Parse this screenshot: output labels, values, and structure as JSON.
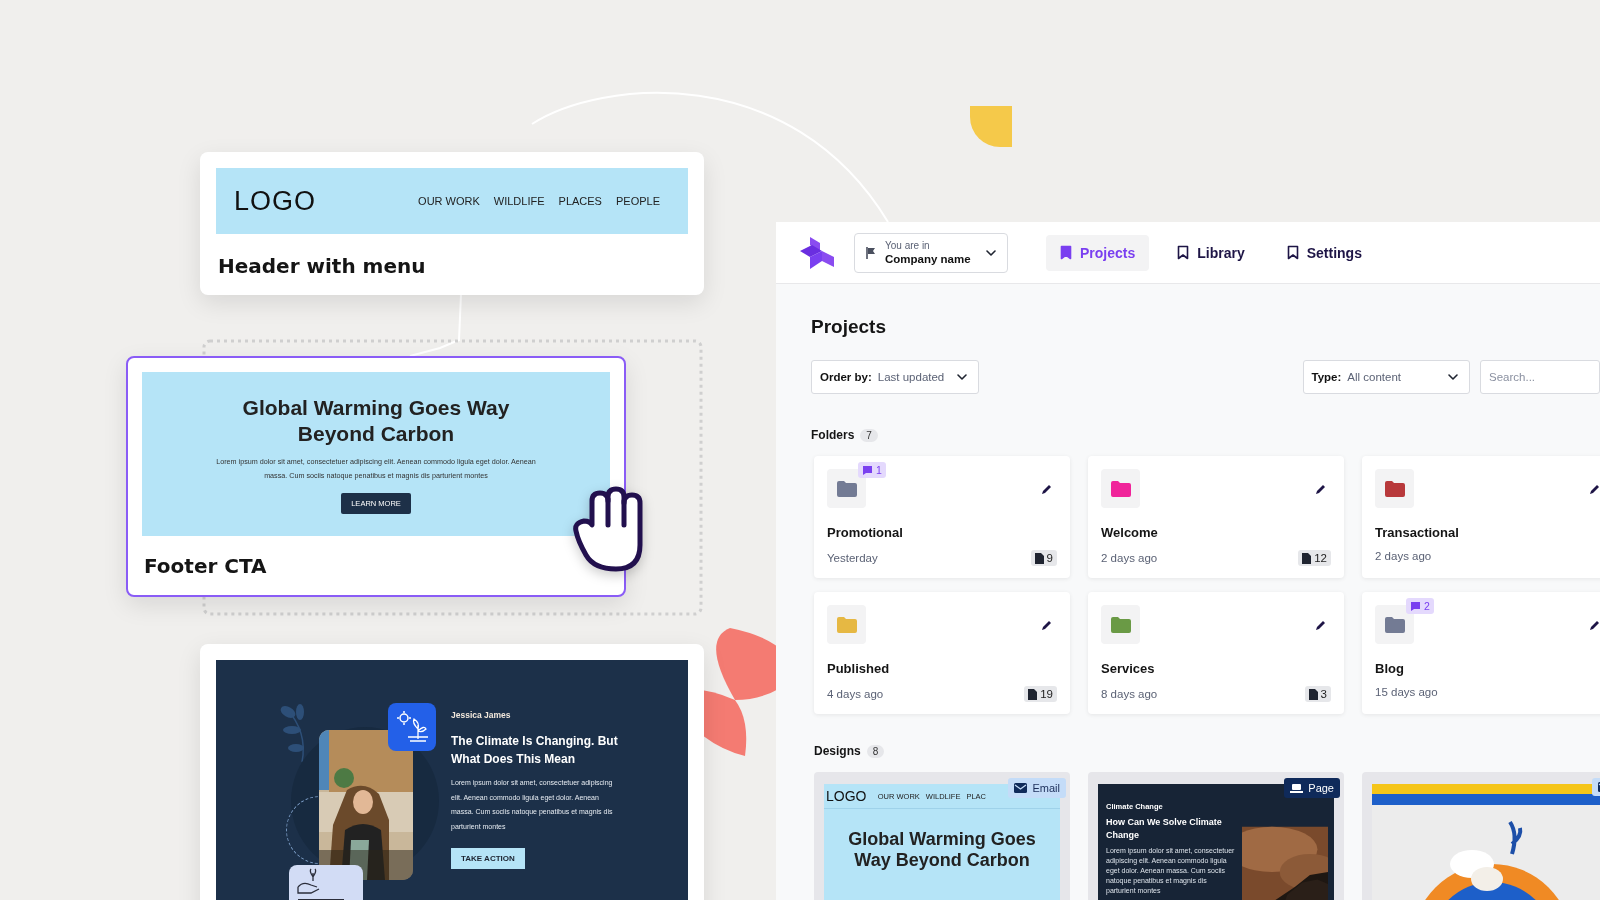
{
  "templates": [
    {
      "kind": "header",
      "logo": "LOGO",
      "menu": [
        "OUR WORK",
        "WILDLIFE",
        "PLACES",
        "PEOPLE"
      ],
      "title": "Header with menu",
      "selected": false
    },
    {
      "kind": "cta",
      "headline": "Global Warming Goes Way Beyond Carbon",
      "body": "Lorem ipsum dolor sit amet, consectetuer adipiscing elit. Aenean commodo ligula eget dolor. Aenean massa. Cum sociis natoque penatibus et magnis dis parturient montes",
      "button": "LEARN MORE",
      "title": "Footer CTA",
      "selected": true
    },
    {
      "kind": "article",
      "author": "Jessica James",
      "headline": "The Climate Is Changing. But What Does This Mean",
      "body": "Lorem ipsum dolor sit amet, consectetuer adipiscing elit. Aenean commodo ligula eget dolor. Aenean massa. Cum sociis natoque penatibus et magnis dis parturient montes",
      "button": "TAKE ACTION",
      "selected": false
    }
  ],
  "app": {
    "company": {
      "label": "You are in",
      "name": "Company name"
    },
    "nav": [
      {
        "label": "Projects",
        "selected": true
      },
      {
        "label": "Library",
        "selected": false
      },
      {
        "label": "Settings",
        "selected": false
      }
    ],
    "title": "Projects",
    "order": {
      "label": "Order by:",
      "value": "Last updated"
    },
    "type": {
      "label": "Type:",
      "value": "All content"
    },
    "search": {
      "placeholder": "Search..."
    },
    "folders": {
      "label": "Folders",
      "count": "7",
      "items": [
        {
          "name": "Promotional",
          "updated": "Yesterday",
          "count": "9",
          "color": "#737b94",
          "comments": "1"
        },
        {
          "name": "Welcome",
          "updated": "2 days ago",
          "count": "12",
          "color": "#f0249a"
        },
        {
          "name": "Transactional",
          "updated": "2 days ago",
          "color": "#b8393b"
        },
        {
          "name": "Published",
          "updated": "4 days ago",
          "count": "19",
          "color": "#e6b843"
        },
        {
          "name": "Services",
          "updated": "8 days ago",
          "count": "3",
          "color": "#6a9a45"
        },
        {
          "name": "Blog",
          "updated": "15 days ago",
          "color": "#737b94",
          "comments": "2"
        }
      ]
    },
    "designs": {
      "label": "Designs",
      "count": "8",
      "items": [
        {
          "kind": "email",
          "badge": "Email",
          "preview": {
            "kind": "hero",
            "logo": "LOGO",
            "menu": [
              "OUR WORK",
              "WILDLIFE",
              "PLAC"
            ],
            "headline": "Global Warming Goes Way Beyond Carbon"
          }
        },
        {
          "kind": "page",
          "badge": "Page",
          "preview": {
            "kind": "article",
            "tag": "Climate Change",
            "headline": "How Can We Solve Climate Change",
            "body": "Lorem ipsum dolor sit amet, consectetuer adipiscing elit. Aenean commodo ligula eget dolor. Aenean massa. Cum sociis natoque penatibus et magnis dis parturient montes"
          }
        },
        {
          "kind": "email"
        }
      ]
    }
  }
}
